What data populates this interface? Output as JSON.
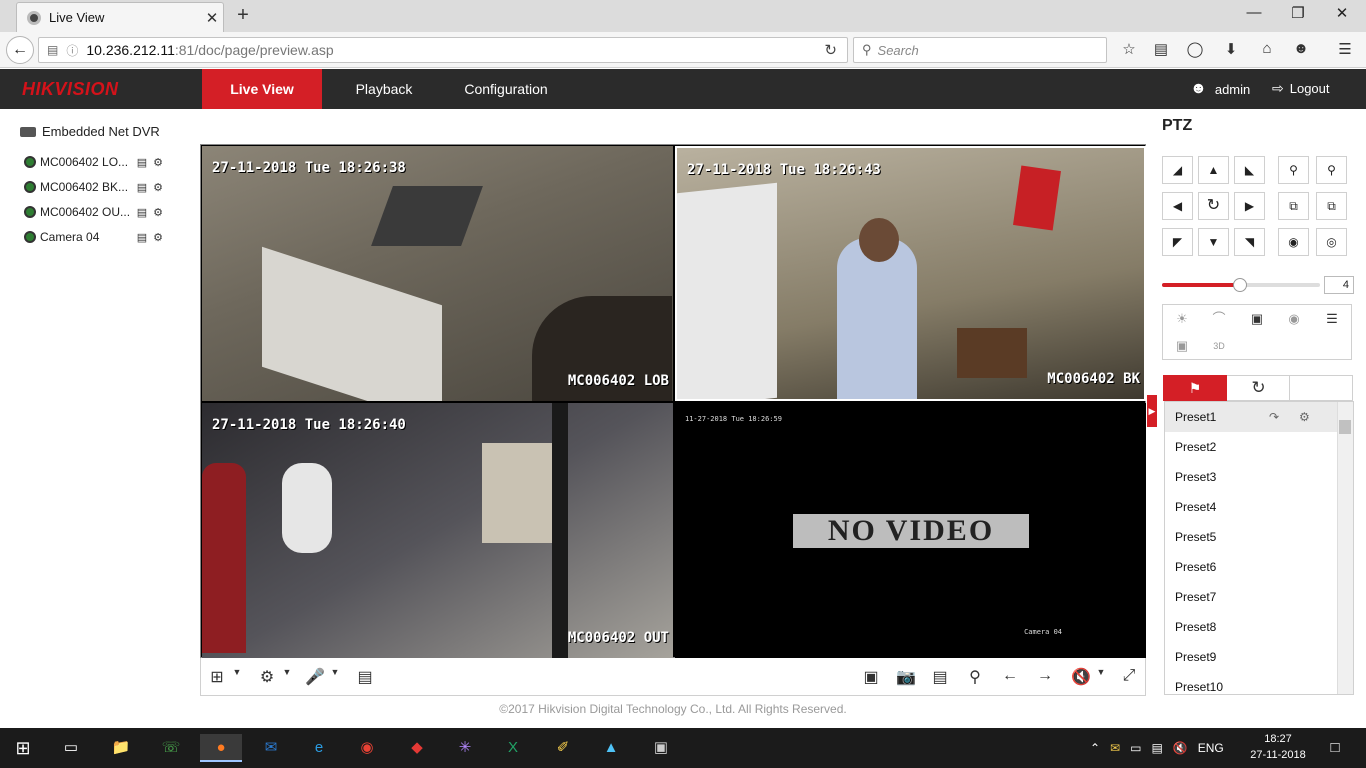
{
  "browser": {
    "tab_title": "Live View",
    "tab_close": "✕",
    "new_tab": "+",
    "url_host": "10.236.212.11",
    "url_path": ":81/doc/page/preview.asp",
    "search_placeholder": "Search",
    "window_minimize": "—",
    "window_maximize": "❐",
    "window_close": "✕"
  },
  "app": {
    "brand": "HIKVISION",
    "nav": [
      "Live View",
      "Playback",
      "Configuration"
    ],
    "user": "admin",
    "logout": "Logout"
  },
  "tree": {
    "root": "Embedded Net DVR",
    "cameras": [
      "MC006402 LO...",
      "MC006402 BK...",
      "MC006402 OU...",
      "Camera 04"
    ]
  },
  "panes": [
    {
      "timestamp": "27-11-2018 Tue 18:26:38",
      "name": "MC006402 LOB"
    },
    {
      "timestamp": "27-11-2018 Tue 18:26:43",
      "name": "MC006402 BK"
    },
    {
      "timestamp": "27-11-2018 Tue 18:26:40",
      "name": "MC006402 OUT"
    },
    {
      "timestamp": "11-27-2018 Tue 18:26:59",
      "name": "Camera 04",
      "status": "NO VIDEO"
    }
  ],
  "footer": "©2017 Hikvision Digital Technology Co., Ltd. All Rights Reserved.",
  "ptz": {
    "title": "PTZ",
    "speed": "4",
    "speed_level": 0.5,
    "presets": [
      "Preset1",
      "Preset2",
      "Preset3",
      "Preset4",
      "Preset5",
      "Preset6",
      "Preset7",
      "Preset8",
      "Preset9",
      "Preset10"
    ]
  },
  "taskbar": {
    "lang": "ENG",
    "time": "18:27",
    "date": "27-11-2018"
  },
  "colors": {
    "accent": "#d41f26",
    "header_bg": "#2b2b2b",
    "taskbar_bg": "#1b1b1b"
  }
}
